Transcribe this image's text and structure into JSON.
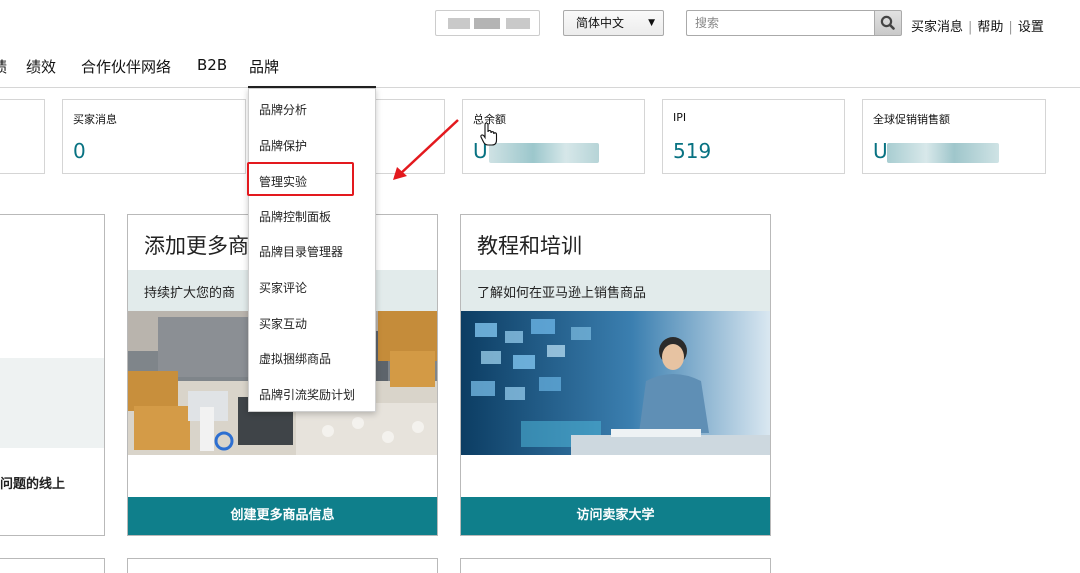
{
  "header": {
    "language": "简体中文",
    "search_placeholder": "搜索",
    "links": [
      "买家消息",
      "帮助",
      "设置"
    ]
  },
  "nav": {
    "items": [
      "绩",
      "绩效",
      "合作伙伴网络",
      "B2B",
      "品牌"
    ],
    "active": "品牌"
  },
  "metrics": [
    {
      "label": "买家消息",
      "value": "0"
    },
    {
      "label": "总余额",
      "value": "U"
    },
    {
      "label": "IPI",
      "value": "519"
    },
    {
      "label": "全球促销销售额",
      "value": "U"
    }
  ],
  "brand_menu": {
    "items": [
      "品牌分析",
      "品牌保护",
      "管理实验",
      "品牌控制面板",
      "品牌目录管理器",
      "买家评论",
      "买家互动",
      "虚拟捆绑商品",
      "品牌引流奖励计划"
    ],
    "highlighted": "管理实验"
  },
  "cards": [
    {
      "title": "添加更多商",
      "subtitle": "持续扩大您的商",
      "button": "创建更多商品信息"
    },
    {
      "title": "教程和培训",
      "subtitle": "了解如何在亚马逊上销售商品",
      "button": "访问卖家大学"
    }
  ],
  "left_card": {
    "text": "问题的线上"
  },
  "colors": {
    "accent": "#0f7f8b",
    "metric_value": "#087282",
    "annotation": "#e3191e"
  }
}
